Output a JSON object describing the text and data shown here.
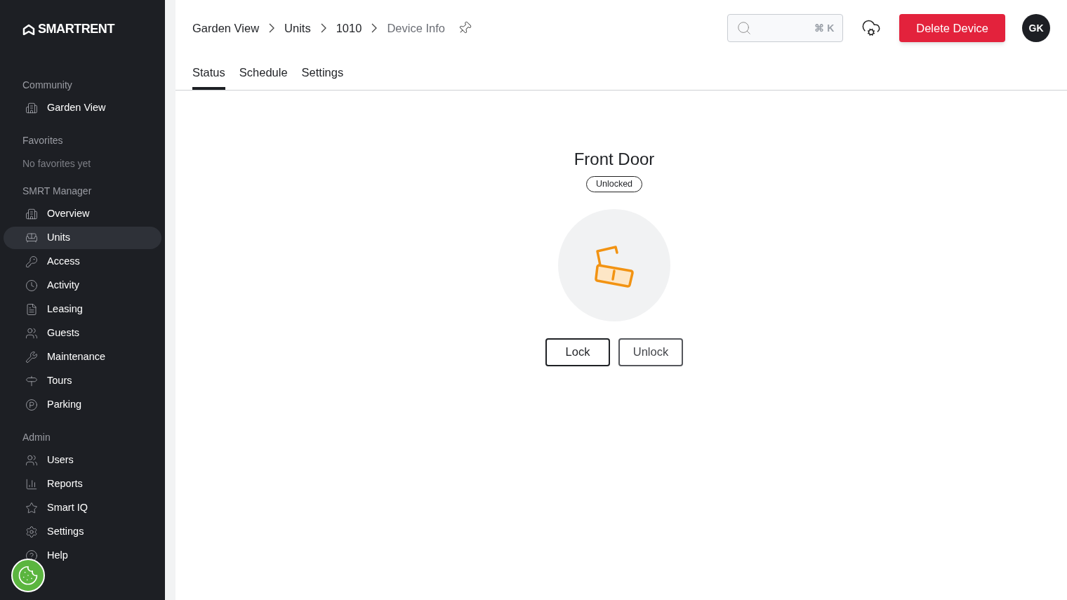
{
  "logo": {
    "text": "SMARTRENT"
  },
  "sidebar": {
    "sections": [
      {
        "title": "Community",
        "items": [
          {
            "label": "Garden View",
            "selected": false
          }
        ]
      },
      {
        "title": "Favorites",
        "empty_text": "No favorites yet"
      },
      {
        "title": "SMRT Manager",
        "items": [
          {
            "label": "Overview",
            "selected": false
          },
          {
            "label": "Units",
            "selected": true
          },
          {
            "label": "Access",
            "selected": false
          },
          {
            "label": "Activity",
            "selected": false
          },
          {
            "label": "Leasing",
            "selected": false
          },
          {
            "label": "Guests",
            "selected": false
          },
          {
            "label": "Maintenance",
            "selected": false
          },
          {
            "label": "Tours",
            "selected": false
          },
          {
            "label": "Parking",
            "selected": false
          }
        ]
      },
      {
        "title": "Admin",
        "items": [
          {
            "label": "Users",
            "selected": false
          },
          {
            "label": "Reports",
            "selected": false
          },
          {
            "label": "Smart IQ",
            "selected": false
          },
          {
            "label": "Settings",
            "selected": false
          },
          {
            "label": "Help",
            "selected": false
          }
        ]
      }
    ]
  },
  "breadcrumbs": [
    {
      "label": "Garden View",
      "current": false
    },
    {
      "label": "Units",
      "current": false
    },
    {
      "label": "1010",
      "current": false
    },
    {
      "label": "Device Info",
      "current": true
    }
  ],
  "search": {
    "shortcut": "⌘ K"
  },
  "delete_button": "Delete Device",
  "avatar": "GK",
  "tabs": [
    {
      "label": "Status",
      "selected": true
    },
    {
      "label": "Schedule",
      "selected": false
    },
    {
      "label": "Settings",
      "selected": false
    }
  ],
  "device": {
    "name": "Front Door",
    "status": "Unlocked",
    "locked": false
  },
  "actions": [
    "Lock",
    "Unlock"
  ]
}
